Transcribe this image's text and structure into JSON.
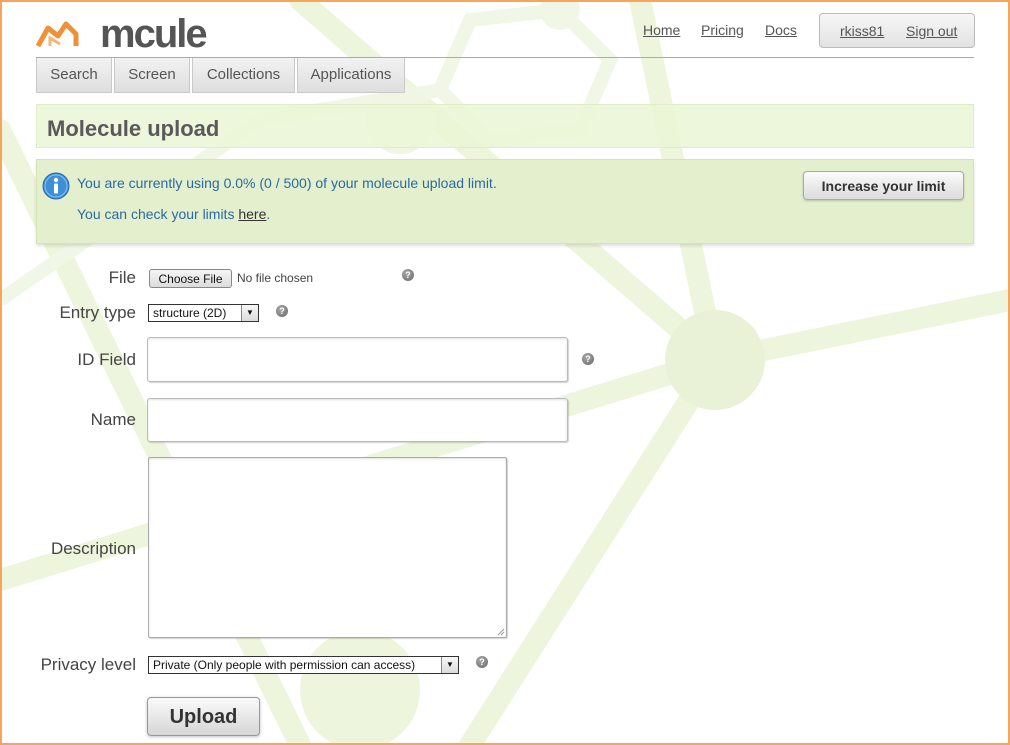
{
  "brand": {
    "logo_text": "mcule"
  },
  "topnav": {
    "home": "Home",
    "pricing": "Pricing",
    "docs": "Docs"
  },
  "user": {
    "username": "rkiss81",
    "signout": "Sign out"
  },
  "tabs": [
    {
      "label": "Search"
    },
    {
      "label": "Screen"
    },
    {
      "label": "Collections"
    },
    {
      "label": "Applications"
    }
  ],
  "page": {
    "title": "Molecule upload"
  },
  "info": {
    "usage_text": "You are currently using 0.0% (0 / 500) of your molecule upload limit.",
    "check_prefix": "You can check your limits ",
    "check_link": "here",
    "check_suffix": ".",
    "increase_button": "Increase your limit"
  },
  "form": {
    "file": {
      "label": "File",
      "button": "Choose File",
      "status": "No file chosen"
    },
    "entry_type": {
      "label": "Entry type",
      "selected": "structure (2D)"
    },
    "id_field": {
      "label": "ID Field",
      "value": ""
    },
    "name": {
      "label": "Name",
      "value": ""
    },
    "description": {
      "label": "Description",
      "value": ""
    },
    "privacy": {
      "label": "Privacy level",
      "selected": "Private (Only people with permission can access)"
    },
    "help_glyph": "?",
    "submit": "Upload"
  },
  "colors": {
    "frame": "#f7a55a",
    "accent_green": "#e3efcd",
    "info_text": "#2a6aa5"
  },
  "icons": [
    "info-icon",
    "help-icon",
    "dropdown-arrow-icon",
    "logo-house-icon"
  ]
}
